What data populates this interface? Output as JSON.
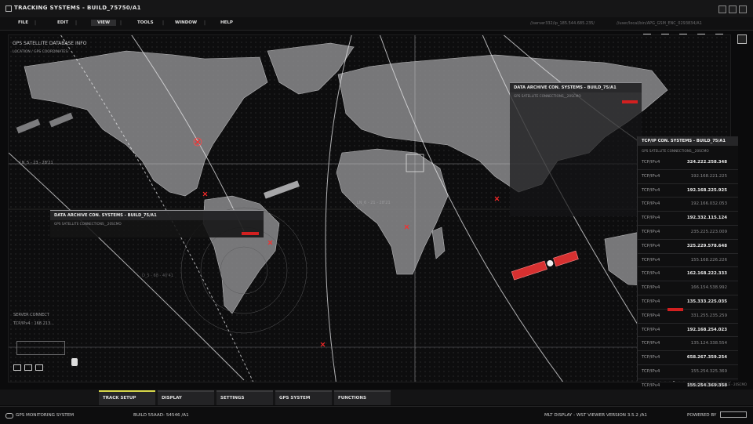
{
  "window": {
    "title": "TRACKING SYSTEMS - BUILD_75750/A1"
  },
  "menu": {
    "items": [
      {
        "label": "FILE"
      },
      {
        "label": "EDIT"
      },
      {
        "label": "VIEW"
      },
      {
        "label": "TOOLS"
      },
      {
        "label": "WINDOW"
      },
      {
        "label": "HELP"
      }
    ],
    "path1": "//server332/ip_185.544.685.235/",
    "path2": "//user/local/bin/APG_GSM_ENC_0293834/A1"
  },
  "map": {
    "header": "GPS SATELLITE DATABASE INFO",
    "subheader": "LOCATION / GPS COORDINATES:",
    "coord_labels": [
      "LN_5 - 23 - 28'21",
      "LN_6 - 21 - 28'21",
      "D_5 - 68 - 40'41"
    ],
    "server_label": "SERVER CONNECT",
    "server_ip": "TCP/IPv4 : 168.213..."
  },
  "panel_left": {
    "title": "DATA ARCHIVE CON. SYSTEMS - BUILD_75/A1",
    "subtitle": "GPS SATELLITE CONNECTIONS__20SCMO"
  },
  "panel_right": {
    "title": "DATA ARCHIVE CON. SYSTEMS - BUILD_75/A1",
    "subtitle": "GPS SATELLITE CONNECTIONS__20SCMO"
  },
  "ip_panel": {
    "title": "TCP/IP CON. SYSTEMS - BUILD_75/A1",
    "subtitle": "GPS SATELLITE CONNECTIONS__20SCMO",
    "rows": [
      {
        "proto": "TCP/IPv4",
        "addr": "324.222.258.348",
        "dim": false
      },
      {
        "proto": "TCP/IPv4",
        "addr": "192.168.221.225",
        "dim": true
      },
      {
        "proto": "TCP/IPv4",
        "addr": "192.168.225.925",
        "dim": false
      },
      {
        "proto": "TCP/IPv4",
        "addr": "192.166.032.053",
        "dim": true
      },
      {
        "proto": "TCP/IPv4",
        "addr": "192.332.115.124",
        "dim": false
      },
      {
        "proto": "TCP/IPv4",
        "addr": "235.225.223.009",
        "dim": true
      },
      {
        "proto": "TCP/IPv4",
        "addr": "325.229.578.648",
        "dim": false
      },
      {
        "proto": "TCP/IPv4",
        "addr": "155.168.226.226",
        "dim": true
      },
      {
        "proto": "TCP/IPv4",
        "addr": "162.168.222.333",
        "dim": false
      },
      {
        "proto": "TCP/IPv4",
        "addr": "166.154.538.992",
        "dim": true
      },
      {
        "proto": "TCP/IPv4",
        "addr": "135.333.225.035",
        "dim": false
      },
      {
        "proto": "TCP/IPv4",
        "addr": "331.255.235.259",
        "dim": true
      },
      {
        "proto": "TCP/IPv4",
        "addr": "192.168.254.023",
        "dim": false
      },
      {
        "proto": "TCP/IPv4",
        "addr": "135.124.338.554",
        "dim": true
      },
      {
        "proto": "TCP/IPv4",
        "addr": "658.267.359.254",
        "dim": false
      },
      {
        "proto": "TCP/IPv4",
        "addr": "155.254.325.369",
        "dim": true
      },
      {
        "proto": "TCP/IPv4",
        "addr": "155.254.369.358",
        "dim": false
      }
    ],
    "footer": "GPS SATELLITE CON. TABLE - 20SCMO"
  },
  "tabs": [
    {
      "label": "TRACK SETUP",
      "active": true
    },
    {
      "label": "DISPLAY",
      "active": false
    },
    {
      "label": "SETTINGS",
      "active": false
    },
    {
      "label": "GPS SYSTEM",
      "active": false
    },
    {
      "label": "FUNCTIONS",
      "active": false
    }
  ],
  "status": {
    "app": "GPS MONITORING SYSTEM",
    "build": "BUILD 55AAD- 54546 /A1",
    "viewer": "MLT DISPLAY - WST VIEWER VERSION 3.5.2 /A1",
    "powered": "POWERED BY"
  },
  "colors": {
    "accent": "#d8d84a",
    "alert": "#d22020",
    "panel": "#0f0f10"
  }
}
